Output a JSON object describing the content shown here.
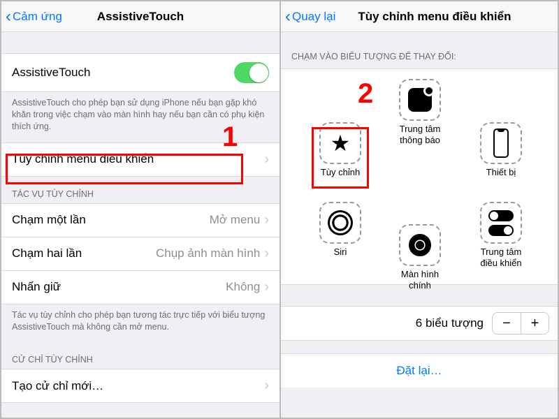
{
  "left": {
    "back": "Cảm ứng",
    "title": "AssistiveTouch",
    "toggle_label": "AssistiveTouch",
    "toggle_on": true,
    "desc": "AssistiveTouch cho phép bạn sử dụng iPhone nếu bạn gặp khó khăn trong việc chạm vào màn hình hay nếu bạn cần có phụ kiện thích ứng.",
    "customize": "Tùy chỉnh menu điều khiển",
    "section_actions": "TÁC VỤ TÙY CHỈNH",
    "tap_once": "Chạm một lần",
    "tap_once_val": "Mở menu",
    "tap_twice": "Chạm hai lần",
    "tap_twice_val": "Chụp ảnh màn hình",
    "long_press": "Nhấn giữ",
    "long_press_val": "Không",
    "actions_foot": "Tác vụ tùy chỉnh cho phép bạn tương tác trực tiếp với biểu tượng AssistiveTouch mà không cần mở menu.",
    "section_gesture": "CỬ CHỈ TÙY CHỈNH",
    "new_gesture": "Tạo cử chỉ mới…",
    "marker": "1"
  },
  "right": {
    "back": "Quay lại",
    "title": "Tùy chỉnh menu điều khiển",
    "hint": "CHẠM VÀO BIỂU TƯỢNG ĐỂ THAY ĐỔI:",
    "items": {
      "notif": "Trung tâm\nthông báo",
      "custom": "Tùy chỉnh",
      "device": "Thiết bị",
      "siri": "Siri",
      "home": "Màn hình chính",
      "cc": "Trung tâm\nđiều khiển"
    },
    "count_label": "6 biểu tượng",
    "reset": "Đặt lại…",
    "marker": "2"
  }
}
